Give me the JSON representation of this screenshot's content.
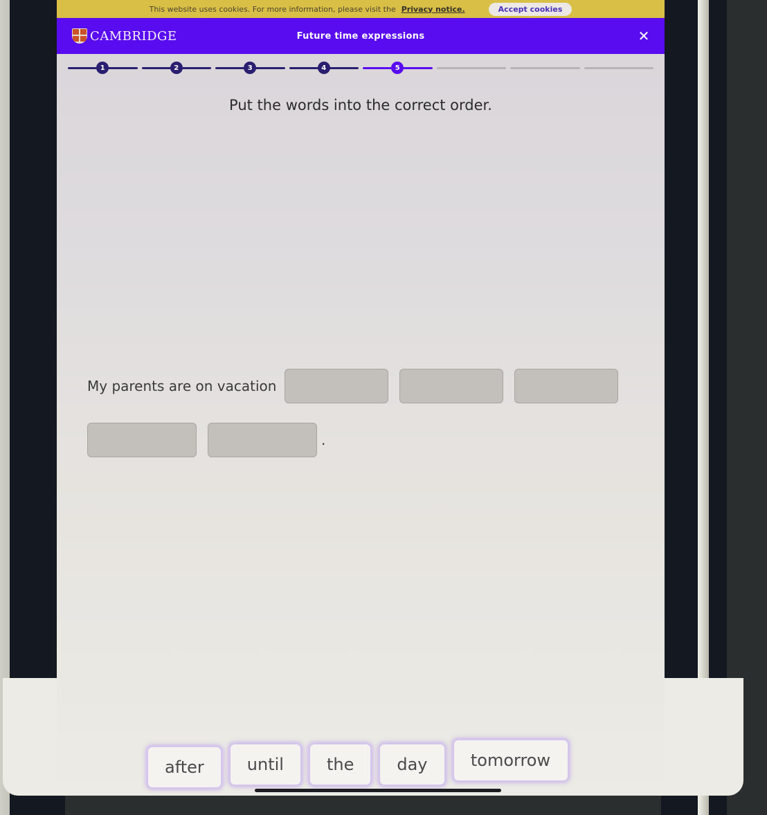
{
  "cookie_banner": {
    "text": "This website uses cookies. For more information, please visit the",
    "privacy_link": "Privacy notice.",
    "accept_button": "Accept cookies"
  },
  "header": {
    "brand": "CAMBRIDGE",
    "logo_icon": "cambridge-shield-icon",
    "title": "Future time expressions",
    "close_icon": "close-icon",
    "close_symbol": "✕"
  },
  "progress": {
    "total_steps": 8,
    "current_step": 5,
    "steps": [
      {
        "label": "1",
        "state": "done"
      },
      {
        "label": "2",
        "state": "done"
      },
      {
        "label": "3",
        "state": "done"
      },
      {
        "label": "4",
        "state": "done"
      },
      {
        "label": "5",
        "state": "current"
      },
      {
        "label": "",
        "state": "upcoming"
      },
      {
        "label": "",
        "state": "upcoming"
      },
      {
        "label": "",
        "state": "upcoming"
      }
    ]
  },
  "exercise": {
    "instruction": "Put the words into the correct order.",
    "sentence_start": "My parents are on vacation",
    "empty_slots": 5,
    "sentence_end": ".",
    "word_bank": [
      "after",
      "until",
      "the",
      "day",
      "tomorrow"
    ]
  },
  "colors": {
    "cookie_bar": "#d9bf45",
    "header": "#5a0cf0",
    "step_done": "#2a1e70",
    "step_current": "#5a0cf0",
    "slot": "#c3c0bb",
    "word_glow": "#b596ec"
  }
}
